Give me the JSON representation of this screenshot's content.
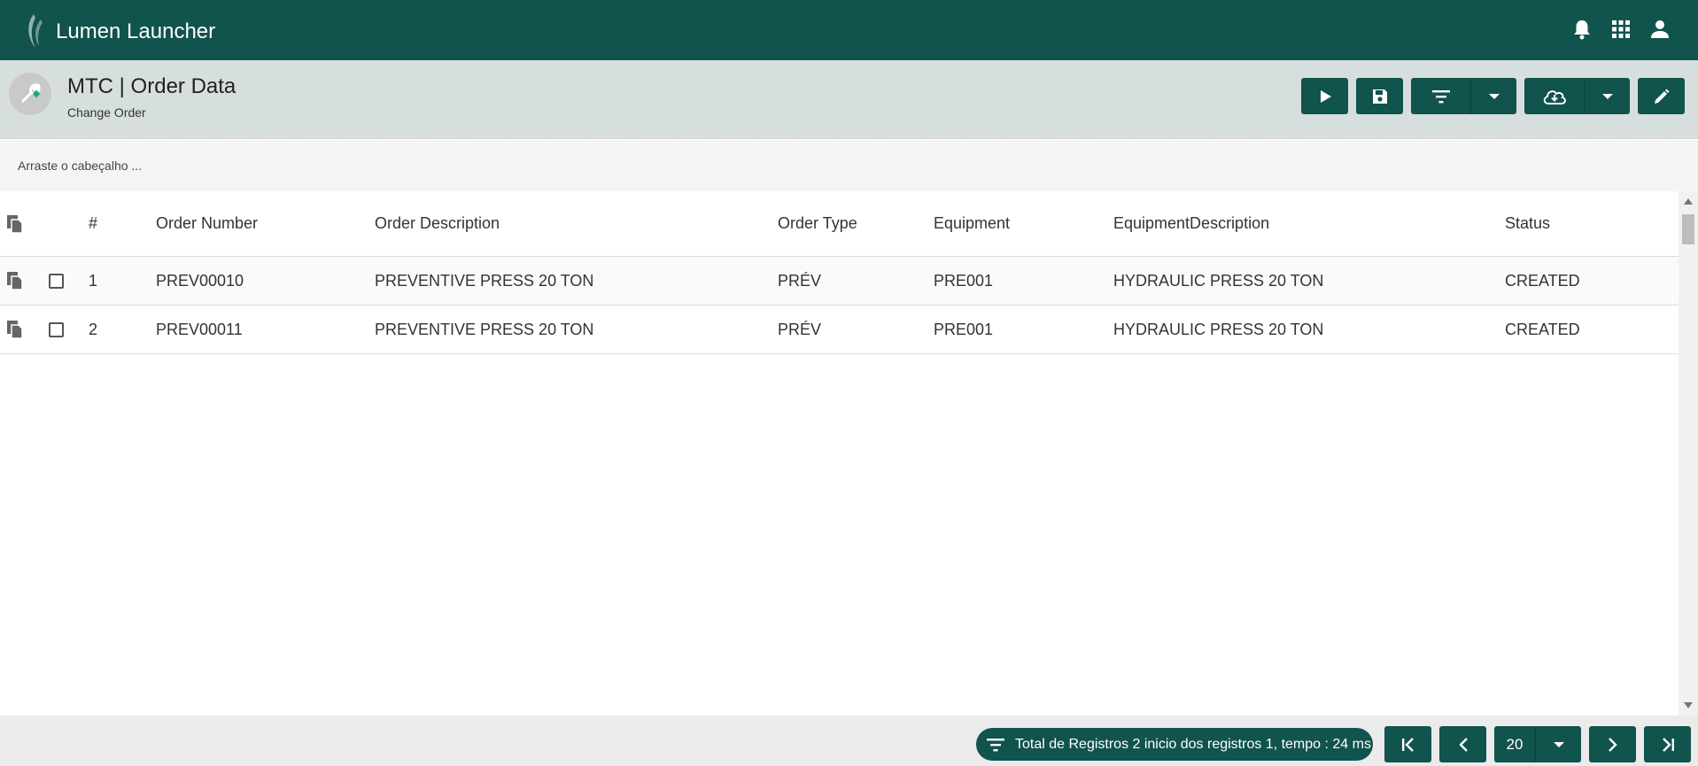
{
  "app": {
    "title": "Lumen Launcher",
    "brand_color": "#11534d",
    "icons": [
      "bell-icon",
      "apps-grid-icon",
      "user-icon"
    ]
  },
  "page": {
    "title": "MTC | Order Data",
    "subtitle": "Change Order",
    "toolbar_icons": [
      "play-icon",
      "save-icon",
      "filter-icon",
      "chevron-down-icon",
      "cloud-download-icon",
      "chevron-down-icon",
      "edit-icon"
    ]
  },
  "group_area": {
    "hint": "Arraste o cabeçalho ..."
  },
  "grid": {
    "columns": [
      "#",
      "Order Number",
      "Order Description",
      "Order Type",
      "Equipment",
      "EquipmentDescription",
      "Status"
    ],
    "rows": [
      {
        "num": "1",
        "order_number": "PREV00010",
        "order_description": "PREVENTIVE PRESS 20 TON",
        "order_type": "PRÉV",
        "equipment": "PRE001",
        "equipment_description": "HYDRAULIC PRESS 20 TON",
        "status": "CREATED"
      },
      {
        "num": "2",
        "order_number": "PREV00011",
        "order_description": "PREVENTIVE PRESS 20 TON",
        "order_type": "PRÉV",
        "equipment": "PRE001",
        "equipment_description": "HYDRAULIC PRESS 20 TON",
        "status": "CREATED"
      }
    ]
  },
  "footer": {
    "status_text": "Total de Registros 2 inicio dos registros 1, tempo : 24 ms",
    "page_size": "20"
  }
}
